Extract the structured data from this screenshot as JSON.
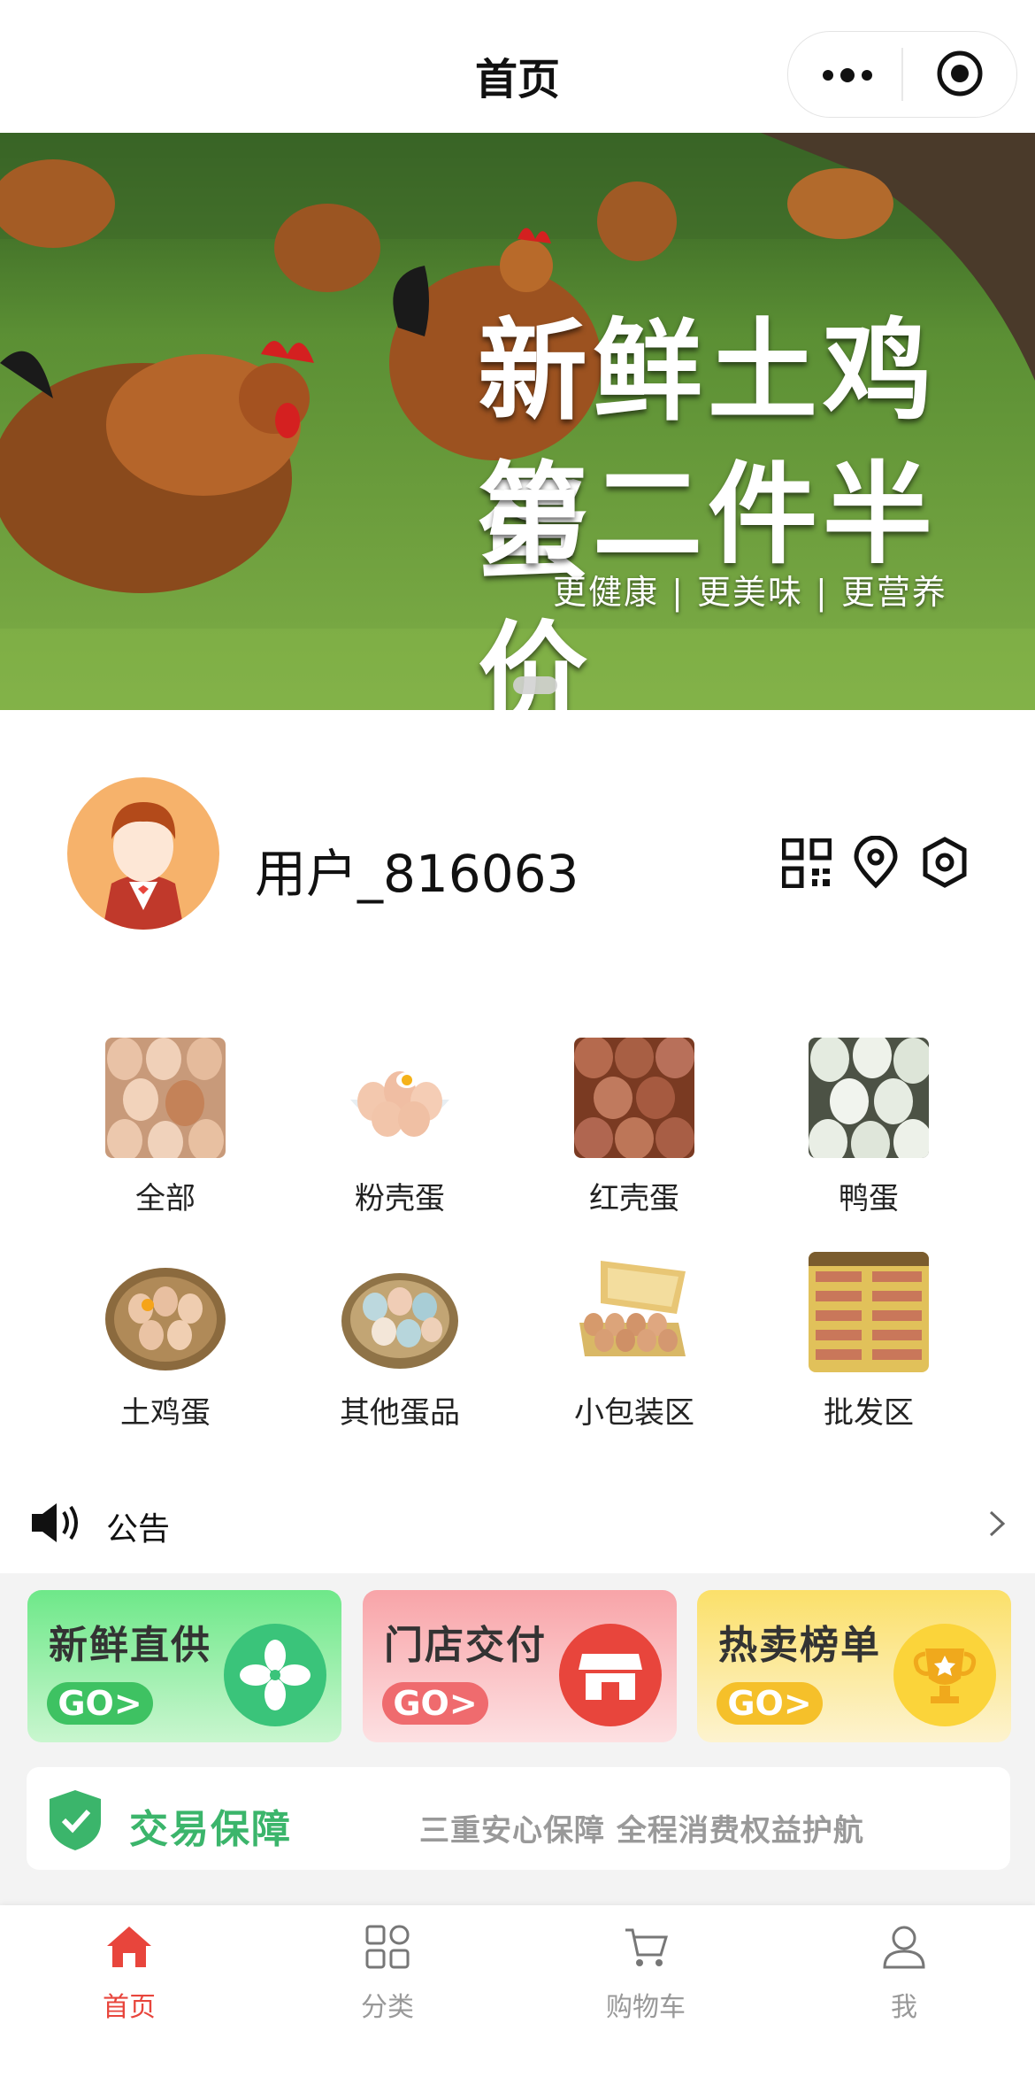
{
  "header": {
    "title": "首页"
  },
  "banner": {
    "title_line1": "新鲜土鸡蛋",
    "title_line2": "第二件半价",
    "subtitle": "更健康 | 更美味 | 更营养"
  },
  "user": {
    "name": "用户_816063"
  },
  "categories": [
    {
      "label": "全部"
    },
    {
      "label": "粉壳蛋"
    },
    {
      "label": "红壳蛋"
    },
    {
      "label": "鸭蛋"
    },
    {
      "label": "土鸡蛋"
    },
    {
      "label": "其他蛋品"
    },
    {
      "label": "小包装区"
    },
    {
      "label": "批发区"
    }
  ],
  "notice": {
    "label": "公告"
  },
  "promos": [
    {
      "title": "新鲜直供",
      "go": "GO>",
      "color": "#3ac47a"
    },
    {
      "title": "门店交付",
      "go": "GO>",
      "color": "#e8453c"
    },
    {
      "title": "热卖榜单",
      "go": "GO>",
      "color": "#f5c02a"
    }
  ],
  "guarantee": {
    "title": "交易保障",
    "desc": "三重安心保障  全程消费权益护航"
  },
  "tabbar": [
    {
      "label": "首页",
      "icon": "home-icon",
      "active": true
    },
    {
      "label": "分类",
      "icon": "category-icon",
      "active": false
    },
    {
      "label": "购物车",
      "icon": "cart-icon",
      "active": false
    },
    {
      "label": "我",
      "icon": "user-icon",
      "active": false
    }
  ],
  "colors": {
    "accent": "#e8453c",
    "green": "#3bb56b"
  }
}
